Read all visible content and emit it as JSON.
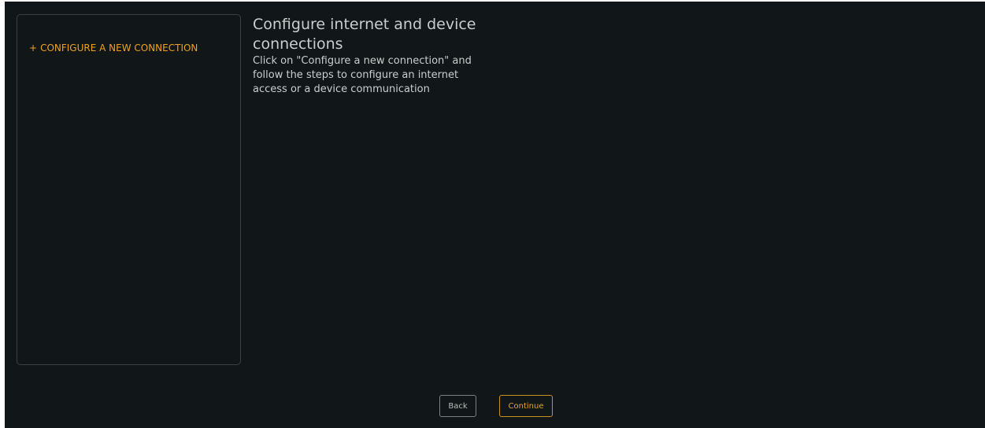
{
  "sidebar": {
    "add_connection_plus": "+",
    "add_connection_label": "CONFIGURE A NEW CONNECTION"
  },
  "main": {
    "title": "Configure internet and device connections",
    "description": "Click on \"Configure a new connection\" and follow the steps to configure an internet access or a device communication"
  },
  "footer": {
    "back_label": "Back",
    "continue_label": "Continue"
  },
  "colors": {
    "background": "#111718",
    "accent": "#f0a020",
    "text": "#c9cdcd",
    "panel_border": "#3a4142"
  }
}
